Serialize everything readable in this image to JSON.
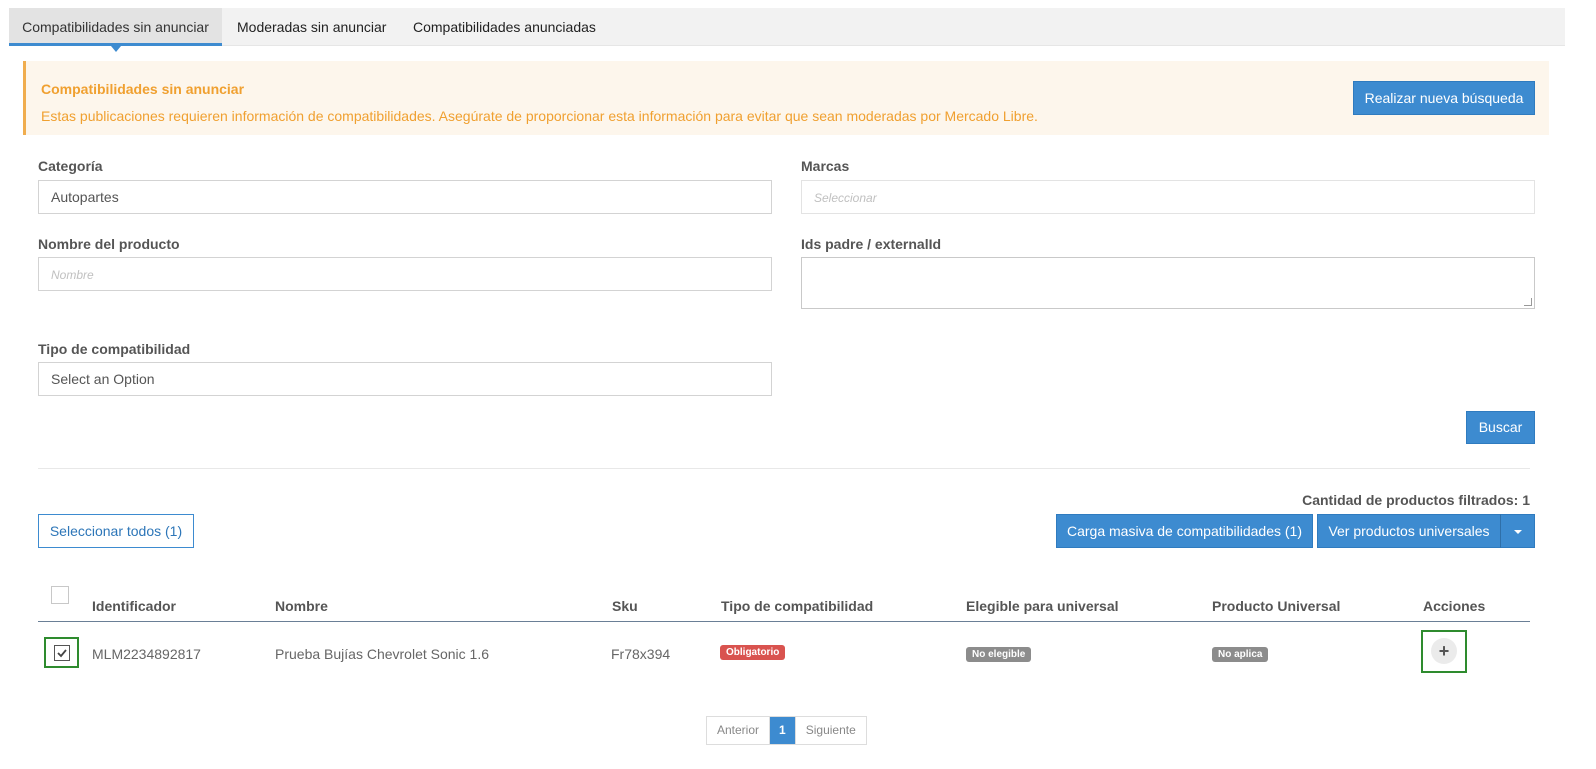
{
  "tabs": [
    {
      "label": "Compatibilidades sin anunciar",
      "active": true
    },
    {
      "label": "Moderadas sin anunciar",
      "active": false
    },
    {
      "label": "Compatibilidades anunciadas",
      "active": false
    }
  ],
  "alert": {
    "title": "Compatibilidades sin anunciar",
    "text": "Estas publicaciones requieren información de compatibilidades. Asegúrate de proporcionar esta información para evitar que sean moderadas por Mercado Libre.",
    "button_label": "Realizar nueva búsqueda",
    "color": "#f0a030"
  },
  "form": {
    "categoria": {
      "label": "Categoría",
      "value": "Autopartes"
    },
    "marcas": {
      "label": "Marcas",
      "placeholder": "Seleccionar"
    },
    "nombre": {
      "label": "Nombre del producto",
      "placeholder": "Nombre"
    },
    "ids": {
      "label": "Ids padre / externalId",
      "value": ""
    },
    "tipo": {
      "label": "Tipo de compatibilidad",
      "value": "Select an Option"
    },
    "search_button": "Buscar"
  },
  "results": {
    "count_text": "Cantidad de productos filtrados: 1",
    "select_all_label": "Seleccionar todos (1)",
    "bulk_label": "Carga masiva de compatibilidades (1)",
    "universal_label": "Ver productos universales"
  },
  "table": {
    "headers": [
      "Identificador",
      "Nombre",
      "Sku",
      "Tipo de compatibilidad",
      "Elegible para universal",
      "Producto Universal",
      "Acciones"
    ],
    "rows": [
      {
        "checked": true,
        "identificador": "MLM2234892817",
        "nombre": "Prueba Bujías Chevrolet Sonic 1.6",
        "sku": "Fr78x394",
        "tipo": "Obligatorio",
        "elegible": "No elegible",
        "universal": "No aplica",
        "action_icon": "plus-icon"
      }
    ]
  },
  "pagination": {
    "prev": "Anterior",
    "current": "1",
    "next": "Siguiente"
  },
  "colors": {
    "primary": "#3d8bd0",
    "warning": "#f0ad4e",
    "danger": "#d9534f",
    "highlight": "#2e8b2e"
  }
}
